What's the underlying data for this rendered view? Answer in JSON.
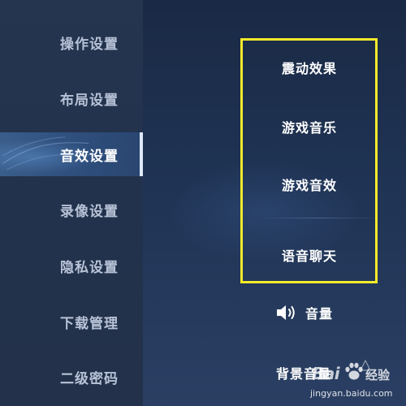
{
  "sidebar": {
    "items": [
      {
        "label": "操作设置",
        "active": false
      },
      {
        "label": "布局设置",
        "active": false
      },
      {
        "label": "音效设置",
        "active": true
      },
      {
        "label": "录像设置",
        "active": false
      },
      {
        "label": "隐私设置",
        "active": false
      },
      {
        "label": "下载管理",
        "active": false
      },
      {
        "label": "二级密码",
        "active": false
      }
    ]
  },
  "main": {
    "highlighted_options": [
      {
        "label": "震动效果"
      },
      {
        "label": "游戏音乐"
      },
      {
        "label": "游戏音效"
      },
      {
        "label": "语音聊天"
      }
    ],
    "volume": {
      "label": "音量",
      "icon": "speaker-icon"
    },
    "bgm_volume": {
      "label": "背景音量"
    }
  },
  "watermark": {
    "logo": "Bai",
    "label": "经验",
    "url": "jingyan.baidu.com"
  },
  "colors": {
    "highlight_border": "#f5ea2a",
    "active_tab": "#2e4e7c",
    "background": "#1e2f4d"
  }
}
